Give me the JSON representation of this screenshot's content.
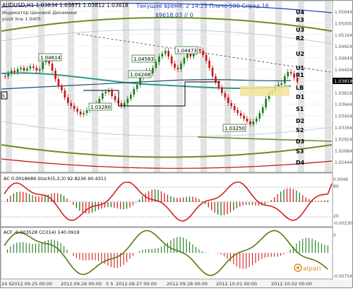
{
  "header": {
    "symbol_line": "AUDUSD,H1  1.03834 1.03871 1.03812 1.03818",
    "indicator_name": "Индикатор Ценовой Динамики",
    "pivot_label": "pivot line 1.0405",
    "server_time_label": "Текущее время: 2 14:25 Плечо 500 Спрэд 16",
    "balance_label": "$9618.03     // 0"
  },
  "main_panel": {
    "price_axis_labels": [
      "1.05644",
      "1.05400",
      "1.05164",
      "1.04924",
      "1.04644",
      "1.04404",
      "1.04124",
      "1.03818",
      "1.03644",
      "1.03404",
      "1.03164",
      "1.02924",
      "1.02684",
      "1.02444"
    ],
    "current_price": "1.03818",
    "levels": [
      {
        "name": "U4",
        "color": "#1f3fbf"
      },
      {
        "name": "R3",
        "color": "#6b8e23"
      },
      {
        "name": "U3",
        "color": "#6b8e23"
      },
      {
        "name": "R2",
        "color": "#6b8e23"
      },
      {
        "name": "U2",
        "color": "#6b8e23"
      },
      {
        "name": "U1",
        "color": "#6b8e23"
      },
      {
        "name": "R1",
        "color": "#6b8e23"
      },
      {
        "name": "LB",
        "color": "#e6b800"
      },
      {
        "name": "D1",
        "color": "#6b8e23"
      },
      {
        "name": "S1",
        "color": "#6b8e23"
      },
      {
        "name": "D2",
        "color": "#6b8e23"
      },
      {
        "name": "S2",
        "color": "#6b8e23"
      },
      {
        "name": "D3",
        "color": "#6b8e23"
      },
      {
        "name": "S3",
        "color": "#6b8e23"
      },
      {
        "name": "D4",
        "color": "#c01010"
      }
    ],
    "price_callouts": [
      "1.04614",
      "1.04583",
      "1.04473",
      "1.04248",
      "1.03280",
      "1.03250"
    ],
    "left_box_label": "5"
  },
  "ac_panel": {
    "title": "AC  0.0018689  Stoch(5,3,3)  92.8236  90.4311",
    "axis_labels": [
      "0.0046",
      "80",
      "20",
      "-0.00230"
    ]
  },
  "acf_panel": {
    "title": "ACF  -0.003528  CCI(14)  140.0919",
    "axis_labels": [
      "0",
      "-0.00754"
    ]
  },
  "time_axis": {
    "labels": [
      "24 S",
      "2012.09.25 00:00",
      "2012.09.26 00:00",
      "5 S",
      "2012.09.27 00:00",
      "2012.09.28 00:00",
      "2012.10.01 00:00",
      "2012.10.02 00:00"
    ]
  },
  "watermark": "alpari",
  "colors": {
    "up_candle": "#1a7a1a",
    "down_candle": "#c81414",
    "grid_band": "#e2e2e2",
    "ma_teal": "#2a9a8a",
    "ma_blue": "#1f3fbf",
    "envelope": "#6b8e23",
    "stoch": "#d42020",
    "cci": "#557a12"
  }
}
